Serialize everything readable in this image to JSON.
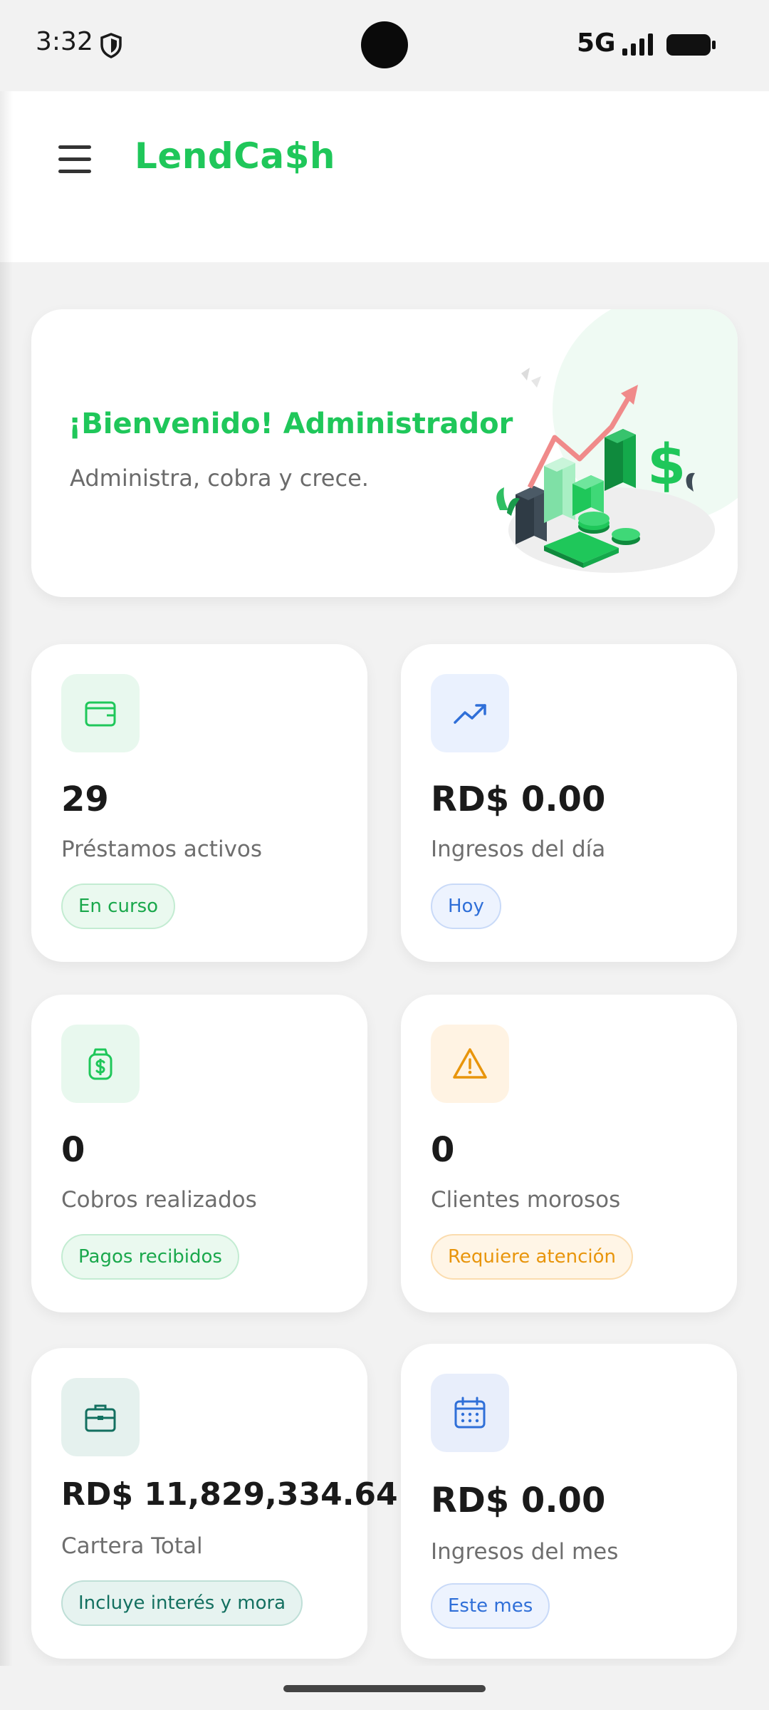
{
  "status_bar": {
    "time": "3:32",
    "network": "5G",
    "icons": [
      "shield-icon",
      "signal-icon",
      "battery-icon"
    ]
  },
  "app_bar": {
    "brand": "LendCa$h",
    "menu_icon": "hamburger-menu-icon",
    "brand_color": "#1fc75a"
  },
  "welcome": {
    "title": "¡Bienvenido! Administrador",
    "subtitle": "Administra, cobra y crece.",
    "illustration": "finance-growth-illustration"
  },
  "stats": [
    {
      "icon": "wallet-icon",
      "value": "29",
      "label": "Préstamos activos",
      "chip": "En curso",
      "color": "#1fc75a"
    },
    {
      "icon": "trending-up-icon",
      "value": "RD$ 0.00",
      "label": "Ingresos del día",
      "chip": "Hoy",
      "color": "#2f6fd8"
    },
    {
      "icon": "money-bag-icon",
      "value": "0",
      "label": "Cobros realizados",
      "chip": "Pagos recibidos",
      "color": "#1fc75a"
    },
    {
      "icon": "warning-icon",
      "value": "0",
      "label": "Clientes morosos",
      "chip": "Requiere atención",
      "color": "#e8950c"
    },
    {
      "icon": "briefcase-icon",
      "value": "RD$ 11,829,334.64",
      "label": "Cartera Total",
      "chip": "Incluye interés y mora",
      "color": "#137060"
    },
    {
      "icon": "calendar-icon",
      "value": "RD$ 0.00",
      "label": "Ingresos del mes",
      "chip": "Este mes",
      "color": "#2f6fd8"
    }
  ]
}
